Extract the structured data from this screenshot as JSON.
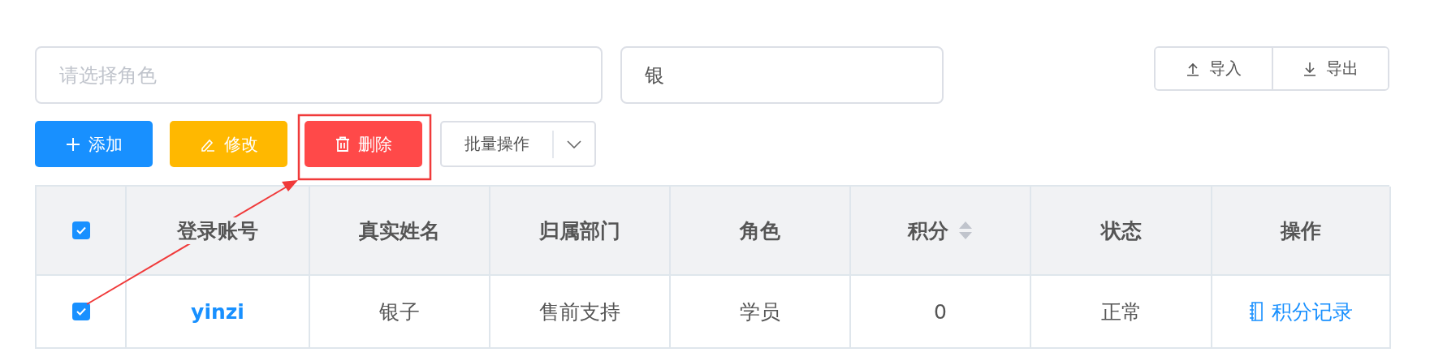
{
  "filters": {
    "role": {
      "placeholder": "请选择角色"
    },
    "name": {
      "value": "银"
    }
  },
  "io_buttons": [
    {
      "kind": "import",
      "label": "导入"
    },
    {
      "kind": "export",
      "label": "导出"
    }
  ],
  "actions": [
    {
      "kind": "add",
      "label": "添加"
    },
    {
      "kind": "edit",
      "label": "修改"
    },
    {
      "kind": "delete",
      "label": "删除"
    }
  ],
  "batch": {
    "label": "批量操作"
  },
  "table": {
    "select_all": true,
    "columns": [
      {
        "label": "登录账号",
        "sortable": false
      },
      {
        "label": "真实姓名",
        "sortable": false
      },
      {
        "label": "归属部门",
        "sortable": false
      },
      {
        "label": "角色",
        "sortable": false
      },
      {
        "label": "积分",
        "sortable": true
      },
      {
        "label": "状态",
        "sortable": false
      },
      {
        "label": "操作",
        "sortable": false
      }
    ],
    "rows": [
      {
        "selected": true,
        "cells": [
          "yinzi",
          "银子",
          "售前支持",
          "学员",
          "0",
          "正常"
        ],
        "action": "积分记录"
      }
    ]
  }
}
